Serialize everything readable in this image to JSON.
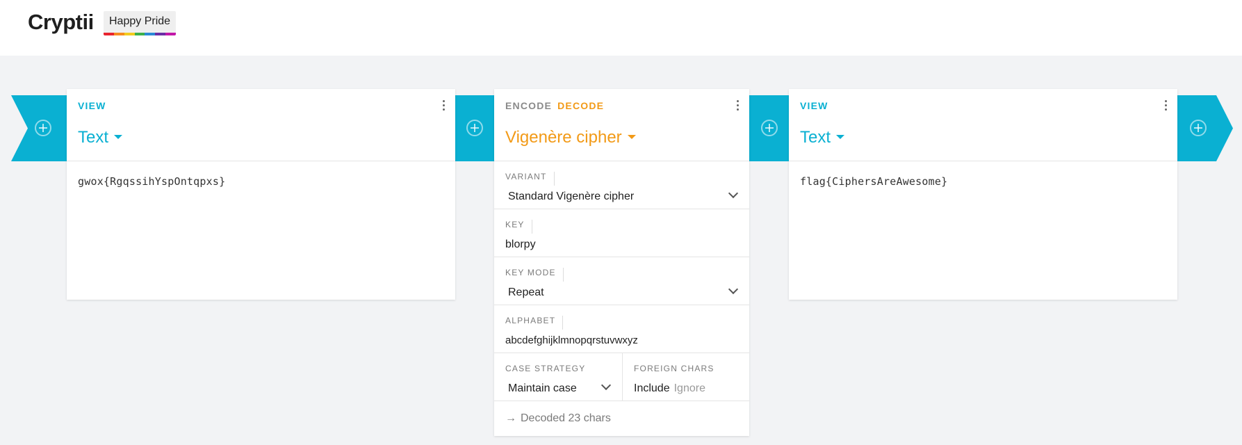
{
  "app": {
    "title": "Cryptii",
    "badge": "Happy Pride",
    "pride_colors": [
      "#e8232f",
      "#f68b1f",
      "#f3cb1f",
      "#3cb04a",
      "#2b8ad6",
      "#6a2fa5",
      "#c218a8"
    ]
  },
  "colors": {
    "view_accent": "#0ab0d2",
    "encoder_accent": "#f29a17",
    "pipe": "#0ab0d2"
  },
  "left_view": {
    "kind": "VIEW",
    "title": "Text",
    "content": "gwox{RgqssihYspOntqpxs}"
  },
  "encoder": {
    "encode_label": "ENCODE",
    "decode_label": "DECODE",
    "active_mode": "decode",
    "title": "Vigenère cipher",
    "variant": {
      "label": "VARIANT",
      "value": "Standard Vigenère cipher"
    },
    "key": {
      "label": "KEY",
      "value": "blorpy"
    },
    "key_mode": {
      "label": "KEY MODE",
      "value": "Repeat"
    },
    "alphabet": {
      "label": "ALPHABET",
      "value": "abcdefghijklmnopqrstuvwxyz"
    },
    "case_strategy": {
      "label": "CASE STRATEGY",
      "value": "Maintain case"
    },
    "foreign_chars": {
      "label": "FOREIGN CHARS",
      "options": [
        "Include",
        "Ignore"
      ],
      "selected": "Include"
    },
    "status": "Decoded 23 chars"
  },
  "right_view": {
    "kind": "VIEW",
    "title": "Text",
    "content": "flag{CiphersAreAwesome}"
  },
  "icons": {
    "add": "plus-circle-icon",
    "menu": "more-vertical-icon",
    "dropdown": "caret-down-icon",
    "select": "chevron-down-icon",
    "status": "arrow-right-icon"
  }
}
